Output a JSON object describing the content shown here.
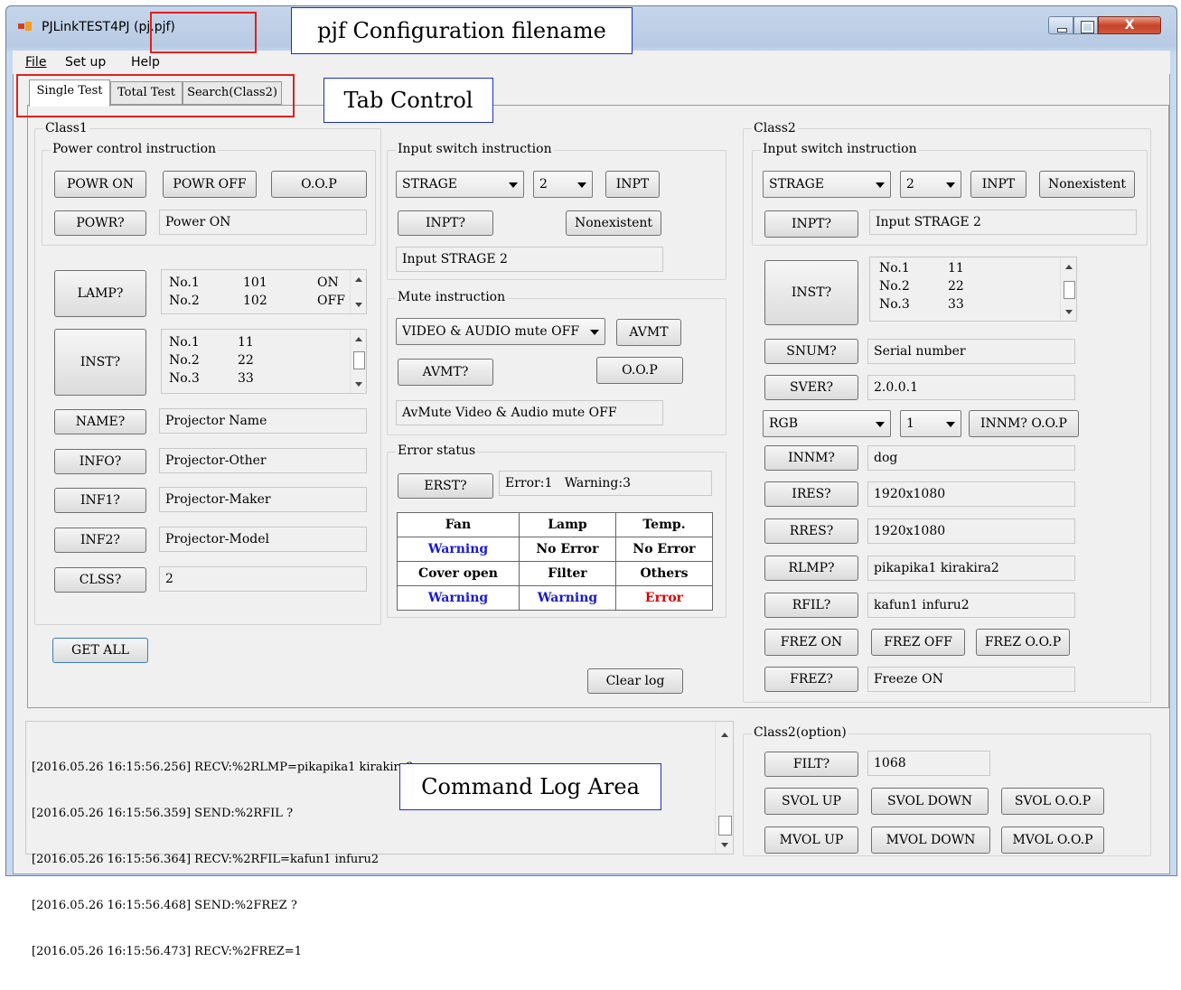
{
  "window": {
    "title": "PJLinkTEST4PJ (pj.pjf)"
  },
  "menu": [
    "File",
    "Set up",
    "Help"
  ],
  "tabs": [
    "Single Test",
    "Total Test",
    "Search(Class2)"
  ],
  "callouts": {
    "filename": "pjf Configuration filename",
    "tab_control": "Tab Control",
    "log_area": "Command Log Area"
  },
  "class1": {
    "label": "Class1",
    "power": {
      "label": "Power control instruction",
      "buttons": [
        "POWR ON",
        "POWR OFF",
        "O.O.P"
      ],
      "query": "POWR?",
      "value": "Power ON"
    },
    "lamp": {
      "button": "LAMP?",
      "rows": [
        {
          "no": "No.1",
          "hours": "101",
          "state": "ON"
        },
        {
          "no": "No.2",
          "hours": "102",
          "state": "OFF"
        }
      ]
    },
    "inst": {
      "button": "INST?",
      "rows": [
        {
          "no": "No.1",
          "val": "11"
        },
        {
          "no": "No.2",
          "val": "22"
        },
        {
          "no": "No.3",
          "val": "33"
        }
      ]
    },
    "queries": [
      {
        "button": "NAME?",
        "value": "Projector Name"
      },
      {
        "button": "INFO?",
        "value": "Projector-Other"
      },
      {
        "button": "INF1?",
        "value": "Projector-Maker"
      },
      {
        "button": "INF2?",
        "value": "Projector-Model"
      },
      {
        "button": "CLSS?",
        "value": "2"
      }
    ],
    "get_all": "GET ALL"
  },
  "input1": {
    "label": "Input switch instruction",
    "source": "STRAGE",
    "number": "2",
    "inpt": "INPT",
    "query": "INPT?",
    "nonexistent": "Nonexistent",
    "value": "Input STRAGE 2"
  },
  "mute": {
    "label": "Mute instruction",
    "option": "VIDEO & AUDIO mute OFF",
    "avmt": "AVMT",
    "query": "AVMT?",
    "oop": "O.O.P",
    "value": "AvMute Video & Audio mute OFF"
  },
  "error": {
    "label": "Error status",
    "query": "ERST?",
    "value": "Error:1   Warning:3",
    "headers1": [
      "Fan",
      "Lamp",
      "Temp."
    ],
    "values1": [
      {
        "text": "Warning",
        "color": "#1a1ad6"
      },
      {
        "text": "No Error",
        "color": "#000000"
      },
      {
        "text": "No Error",
        "color": "#000000"
      }
    ],
    "headers2": [
      "Cover open",
      "Filter",
      "Others"
    ],
    "values2": [
      {
        "text": "Warning",
        "color": "#1a1ad6"
      },
      {
        "text": "Warning",
        "color": "#1a1ad6"
      },
      {
        "text": "Error",
        "color": "#e00000"
      }
    ]
  },
  "clear_log": "Clear log",
  "class2": {
    "label": "Class2",
    "input": {
      "label": "Input switch instruction",
      "source": "STRAGE",
      "number": "2",
      "inpt": "INPT",
      "nonexistent": "Nonexistent",
      "query": "INPT?",
      "value": "Input STRAGE 2"
    },
    "inst": {
      "button": "INST?",
      "rows": [
        {
          "no": "No.1",
          "val": "11"
        },
        {
          "no": "No.2",
          "val": "22"
        },
        {
          "no": "No.3",
          "val": "33"
        }
      ]
    },
    "snum": {
      "button": "SNUM?",
      "value": "Serial number"
    },
    "sver": {
      "button": "SVER?",
      "value": "2.0.0.1"
    },
    "innm_sel": {
      "source": "RGB",
      "number": "1",
      "oop": "INNM? O.O.P"
    },
    "innm": {
      "button": "INNM?",
      "value": "dog"
    },
    "ires": {
      "button": "IRES?",
      "value": "1920x1080"
    },
    "rres": {
      "button": "RRES?",
      "value": "1920x1080"
    },
    "rlmp": {
      "button": "RLMP?",
      "value": "pikapika1 kirakira2"
    },
    "rfil": {
      "button": "RFIL?",
      "value": "kafun1 infuru2"
    },
    "frez_buttons": [
      "FREZ ON",
      "FREZ OFF",
      "FREZ O.O.P"
    ],
    "frez": {
      "button": "FREZ?",
      "value": "Freeze ON"
    }
  },
  "class2opt": {
    "label": "Class2(option)",
    "filt": {
      "button": "FILT?",
      "value": "1068"
    },
    "svol": [
      "SVOL UP",
      "SVOL DOWN",
      "SVOL O.O.P"
    ],
    "mvol": [
      "MVOL UP",
      "MVOL DOWN",
      "MVOL O.O.P"
    ]
  },
  "log": [
    "[2016.05.26 16:15:56.256] RECV:%2RLMP=pikapika1 kirakira2",
    "[2016.05.26 16:15:56.359] SEND:%2RFIL ?",
    "[2016.05.26 16:15:56.364] RECV:%2RFIL=kafun1 infuru2",
    "[2016.05.26 16:15:56.468] SEND:%2FREZ ?",
    "[2016.05.26 16:15:56.473] RECV:%2FREZ=1"
  ]
}
